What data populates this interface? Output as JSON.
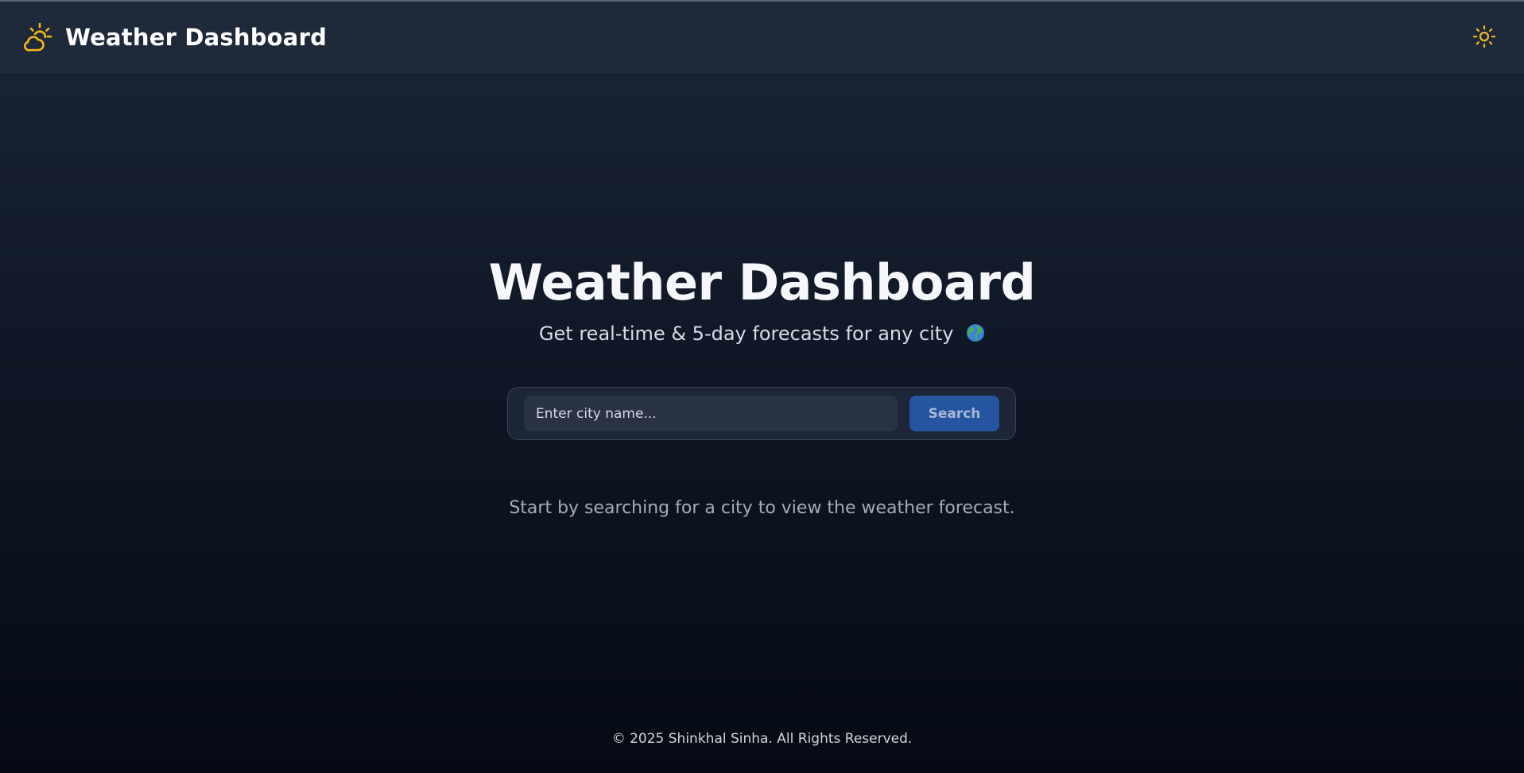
{
  "navbar": {
    "brand_icon": "sun-behind-cloud-icon",
    "title": "Weather Dashboard",
    "theme_toggle_icon": "sun-icon",
    "accent_color": "#f5b81c"
  },
  "hero": {
    "title": "Weather Dashboard",
    "subtitle": "Get real-time & 5-day forecasts for any city",
    "subtitle_icon": "globe-icon"
  },
  "search": {
    "placeholder": "Enter city name...",
    "value": "",
    "button_label": "Search",
    "button_color": "#2554a0"
  },
  "empty_state": {
    "message": "Start by searching for a city to view the weather forecast."
  },
  "footer": {
    "text": "© 2025 Shinkhal Sinha. All Rights Reserved."
  }
}
